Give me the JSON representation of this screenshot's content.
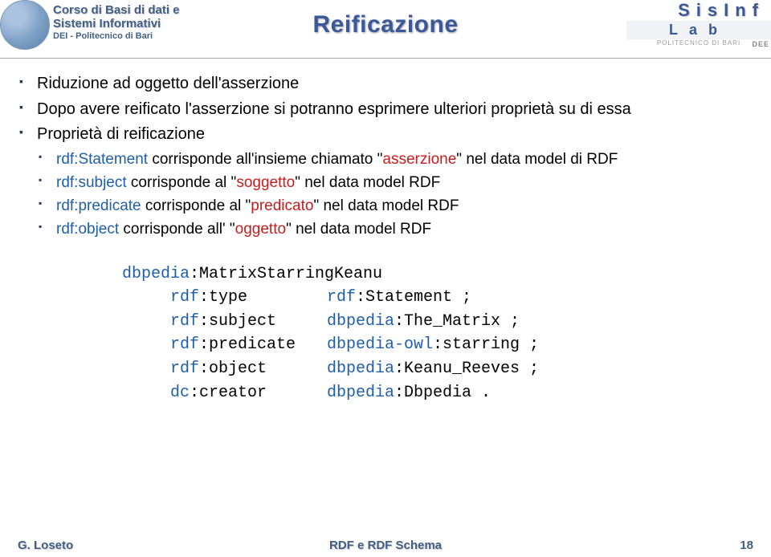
{
  "header": {
    "course_line1": "Corso di Basi di dati e",
    "course_line2": "Sistemi Informativi",
    "course_sub": "DEI - Politecnico di Bari",
    "title": "Reificazione",
    "lab_top": "SisInf",
    "lab_mid": "Lab",
    "lab_bot": "POLITECNICO DI BARI",
    "lab_dee": "DEE"
  },
  "body": {
    "b1": "Riduzione ad oggetto dell'asserzione",
    "b2": "Dopo avere reificato l'asserzione si potranno esprimere ulteriori proprietà su di essa",
    "b3": "Proprietà di reificazione",
    "s1": {
      "pre": "rdf:Statement",
      "mid_a": " corrisponde all'insieme chiamato \"",
      "mid_b": "asserzione",
      "post": "\" nel data model di RDF"
    },
    "s2": {
      "pre": "rdf:subject",
      "mid_a": " corrisponde al \"",
      "mid_b": "soggetto",
      "post": "\" nel data model RDF"
    },
    "s3": {
      "pre": "rdf:predicate",
      "mid_a": " corrisponde al \"",
      "mid_b": "predicato",
      "post": "\" nel data model RDF"
    },
    "s4": {
      "pre": "rdf:object",
      "mid_a": " corrisponde all' \"",
      "mid_b": "oggetto",
      "post": "\" nel data model RDF"
    }
  },
  "code": {
    "subj_prefix": "dbpedia",
    "subj_local": ":MatrixStarringKeanu",
    "rows": [
      {
        "k_prefix": "rdf",
        "k_local": ":type",
        "v_prefix": "rdf",
        "v_local": ":Statement",
        "term": " ;"
      },
      {
        "k_prefix": "rdf",
        "k_local": ":subject",
        "v_prefix": "dbpedia",
        "v_local": ":The_Matrix",
        "term": " ;"
      },
      {
        "k_prefix": "rdf",
        "k_local": ":predicate",
        "v_prefix": "dbpedia-owl",
        "v_local": ":starring",
        "term": " ;"
      },
      {
        "k_prefix": "rdf",
        "k_local": ":object",
        "v_prefix": "dbpedia",
        "v_local": ":Keanu_Reeves",
        "term": " ;"
      },
      {
        "k_prefix": "dc",
        "k_local": ":creator",
        "v_prefix": "dbpedia",
        "v_local": ":Dbpedia",
        "term": " ."
      }
    ]
  },
  "footer": {
    "author": "G. Loseto",
    "title": "RDF e RDF Schema",
    "page": "18"
  }
}
